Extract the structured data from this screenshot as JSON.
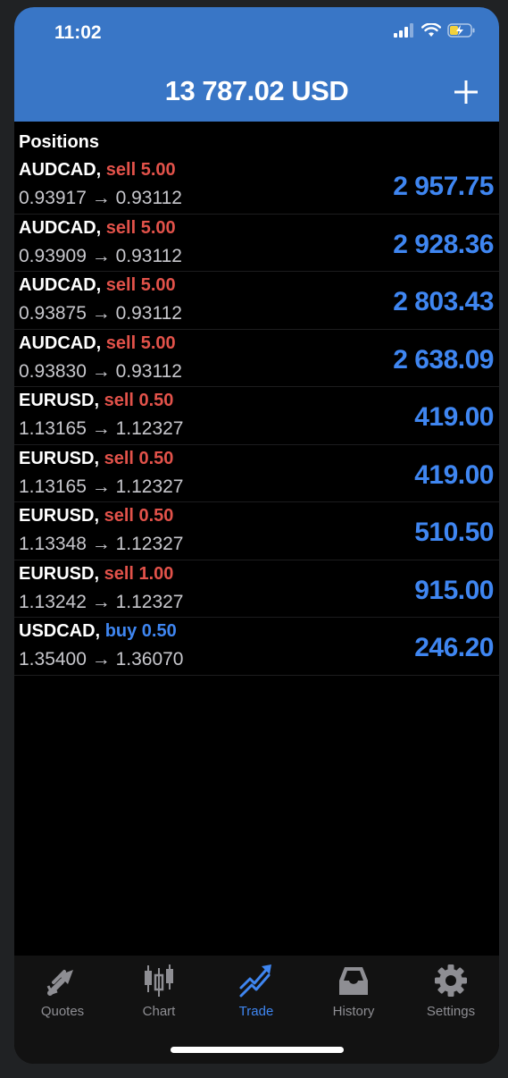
{
  "status_bar": {
    "time": "11:02"
  },
  "header": {
    "balance": "13 787.02 USD"
  },
  "positions_title": "Positions",
  "positions": [
    {
      "symbol": "AUDCAD,",
      "side": "sell 5.00",
      "prices": "0.93917 → 0.93112",
      "profit": "2 957.75"
    },
    {
      "symbol": "AUDCAD,",
      "side": "sell 5.00",
      "prices": "0.93909 → 0.93112",
      "profit": "2 928.36"
    },
    {
      "symbol": "AUDCAD,",
      "side": "sell 5.00",
      "prices": "0.93875 → 0.93112",
      "profit": "2 803.43"
    },
    {
      "symbol": "AUDCAD,",
      "side": "sell 5.00",
      "prices": "0.93830 → 0.93112",
      "profit": "2 638.09"
    },
    {
      "symbol": "EURUSD,",
      "side": "sell 0.50",
      "prices": "1.13165 → 1.12327",
      "profit": "419.00"
    },
    {
      "symbol": "EURUSD,",
      "side": "sell 0.50",
      "prices": "1.13165 → 1.12327",
      "profit": "419.00"
    },
    {
      "symbol": "EURUSD,",
      "side": "sell 0.50",
      "prices": "1.13348 → 1.12327",
      "profit": "510.50"
    },
    {
      "symbol": "EURUSD,",
      "side": "sell 1.00",
      "prices": "1.13242 → 1.12327",
      "profit": "915.00"
    },
    {
      "symbol": "USDCAD,",
      "side": "buy 0.50",
      "prices": "1.35400 → 1.36070",
      "profit": "246.20"
    }
  ],
  "tabs": [
    {
      "label": "Quotes",
      "icon": "quotes-arrows-icon",
      "active": false
    },
    {
      "label": "Chart",
      "icon": "candlestick-icon",
      "active": false
    },
    {
      "label": "Trade",
      "icon": "trade-trend-icon",
      "active": true
    },
    {
      "label": "History",
      "icon": "inbox-tray-icon",
      "active": false
    },
    {
      "label": "Settings",
      "icon": "gear-icon",
      "active": false
    }
  ],
  "colors": {
    "header_blue": "#3976c6",
    "accent_blue": "#3f86f1",
    "sell_red": "#e2524a",
    "background": "#000000"
  }
}
